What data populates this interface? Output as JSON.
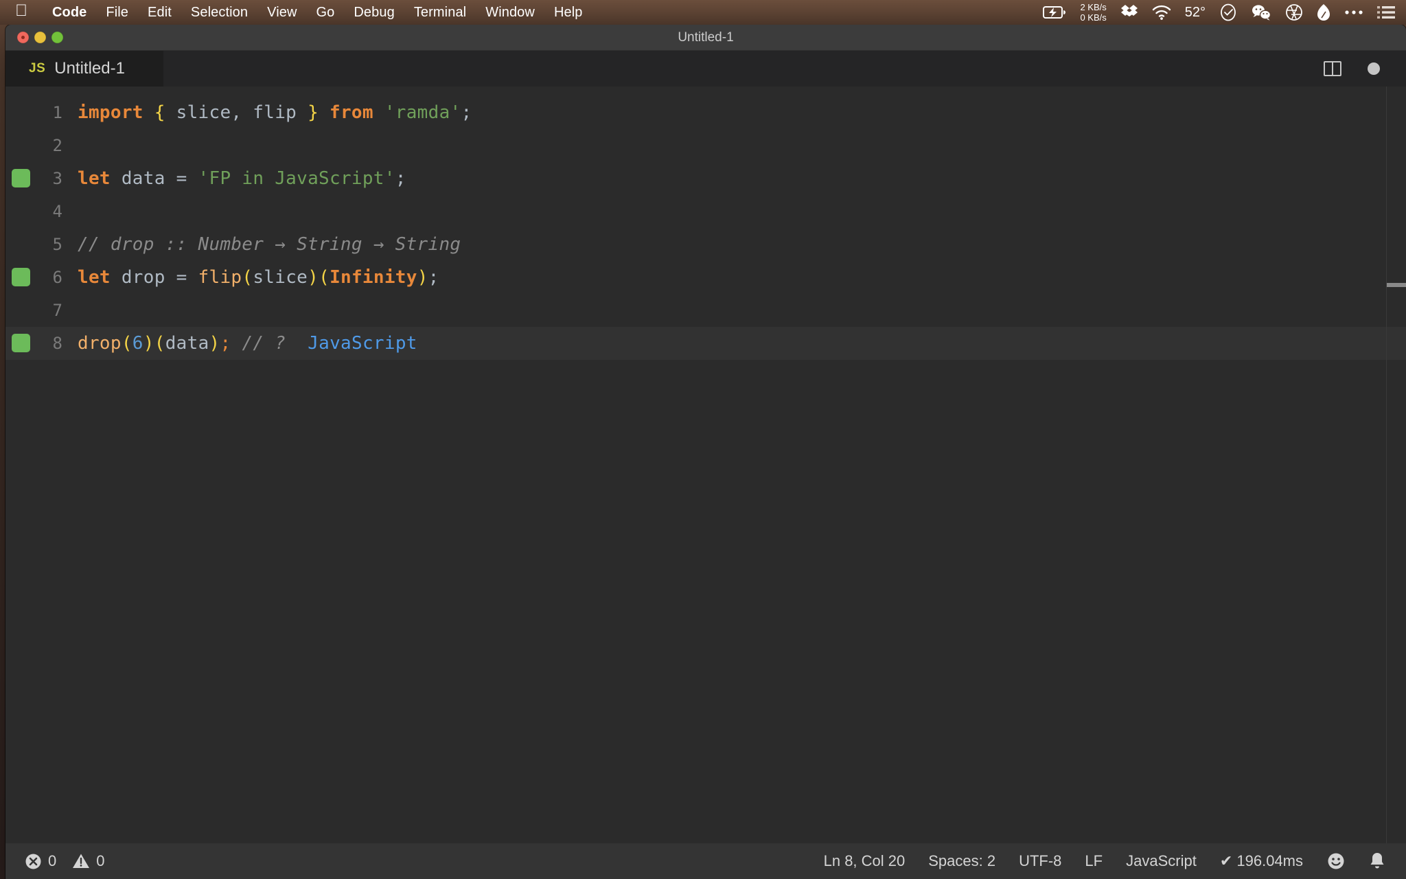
{
  "menubar": {
    "apple_icon": "apple-logo",
    "items": [
      {
        "label": "Code",
        "bold": true
      },
      {
        "label": "File",
        "bold": false
      },
      {
        "label": "Edit",
        "bold": false
      },
      {
        "label": "Selection",
        "bold": false
      },
      {
        "label": "View",
        "bold": false
      },
      {
        "label": "Go",
        "bold": false
      },
      {
        "label": "Debug",
        "bold": false
      },
      {
        "label": "Terminal",
        "bold": false
      },
      {
        "label": "Window",
        "bold": false
      },
      {
        "label": "Help",
        "bold": false
      }
    ],
    "status_icons": [
      {
        "name": "battery-charging-icon"
      },
      {
        "name": "network-speed-indicator"
      },
      {
        "name": "dropbox-icon"
      },
      {
        "name": "wifi-icon"
      },
      {
        "name": "temperature-indicator"
      },
      {
        "name": "clock-icon"
      },
      {
        "name": "wechat-icon"
      },
      {
        "name": "aperture-icon"
      },
      {
        "name": "shape-icon"
      },
      {
        "name": "ellipsis-icon"
      },
      {
        "name": "list-menu-icon"
      }
    ],
    "network_up": "2 KB/s",
    "network_down": "0 KB/s",
    "temperature": "52°"
  },
  "window": {
    "title": "Untitled-1",
    "traffic_lights": [
      "close",
      "minimize",
      "zoom"
    ]
  },
  "tab": {
    "file_icon_label": "JS",
    "label": "Untitled-1",
    "split_editor_icon": "split-editor-icon",
    "dirty_indicator": "unsaved-dot-icon"
  },
  "editor": {
    "lines": [
      {
        "number": "1",
        "marker": false,
        "active": false,
        "tokens": [
          {
            "t": "import",
            "c": "t-kw"
          },
          {
            "t": " ",
            "c": "t-op"
          },
          {
            "t": "{",
            "c": "t-br"
          },
          {
            "t": " slice, flip ",
            "c": "t-var"
          },
          {
            "t": "}",
            "c": "t-br"
          },
          {
            "t": " ",
            "c": "t-op"
          },
          {
            "t": "from",
            "c": "t-kw"
          },
          {
            "t": " ",
            "c": "t-op"
          },
          {
            "t": "'ramda'",
            "c": "t-str"
          },
          {
            "t": ";",
            "c": "t-semi"
          }
        ]
      },
      {
        "number": "2",
        "marker": false,
        "active": false,
        "tokens": []
      },
      {
        "number": "3",
        "marker": true,
        "active": false,
        "tokens": [
          {
            "t": "let",
            "c": "t-kw"
          },
          {
            "t": " data ",
            "c": "t-var"
          },
          {
            "t": "=",
            "c": "t-op"
          },
          {
            "t": " ",
            "c": "t-op"
          },
          {
            "t": "'FP in JavaScript'",
            "c": "t-str"
          },
          {
            "t": ";",
            "c": "t-semi"
          }
        ]
      },
      {
        "number": "4",
        "marker": false,
        "active": false,
        "tokens": []
      },
      {
        "number": "5",
        "marker": false,
        "active": false,
        "tokens": [
          {
            "t": "// drop :: Number → String → String",
            "c": "t-com"
          }
        ]
      },
      {
        "number": "6",
        "marker": true,
        "active": false,
        "tokens": [
          {
            "t": "let",
            "c": "t-kw"
          },
          {
            "t": " drop ",
            "c": "t-var"
          },
          {
            "t": "=",
            "c": "t-op"
          },
          {
            "t": " ",
            "c": "t-op"
          },
          {
            "t": "flip",
            "c": "t-fnname"
          },
          {
            "t": "(",
            "c": "t-br"
          },
          {
            "t": "slice",
            "c": "t-var"
          },
          {
            "t": ")",
            "c": "t-br"
          },
          {
            "t": "(",
            "c": "t-br"
          },
          {
            "t": "Infinity",
            "c": "t-const"
          },
          {
            "t": ")",
            "c": "t-br"
          },
          {
            "t": ";",
            "c": "t-semi"
          }
        ]
      },
      {
        "number": "7",
        "marker": false,
        "active": false,
        "tokens": []
      },
      {
        "number": "8",
        "marker": true,
        "active": true,
        "tokens": [
          {
            "t": "drop",
            "c": "t-fnname"
          },
          {
            "t": "(",
            "c": "t-br"
          },
          {
            "t": "6",
            "c": "t-num"
          },
          {
            "t": ")",
            "c": "t-br"
          },
          {
            "t": "(",
            "c": "t-br"
          },
          {
            "t": "data",
            "c": "t-var"
          },
          {
            "t": ")",
            "c": "t-br"
          },
          {
            "t": ";",
            "c": "t-semi-o"
          },
          {
            "t": " ",
            "c": "t-op"
          },
          {
            "t": "// ?",
            "c": "t-com"
          },
          {
            "t": "  ",
            "c": "t-op"
          },
          {
            "t": "JavaScript",
            "c": "t-result"
          }
        ]
      }
    ]
  },
  "statusbar": {
    "error_count": "0",
    "warning_count": "0",
    "cursor_position": "Ln 8, Col 20",
    "indentation": "Spaces: 2",
    "encoding": "UTF-8",
    "eol": "LF",
    "language": "JavaScript",
    "run_time": "✔ 196.04ms",
    "feedback_icon": "smiley-icon",
    "notification_icon": "bell-icon"
  },
  "colors": {
    "menubar_bg": "#5a4132",
    "editor_bg": "#2b2b2b",
    "active_line_bg": "#323232",
    "statusbar_bg": "#343434",
    "tabbar_bg": "#252526",
    "titlebar_bg": "#3c3c3c",
    "coverage_marker": "#6cbb5a",
    "js_icon": "#cbcb41"
  }
}
